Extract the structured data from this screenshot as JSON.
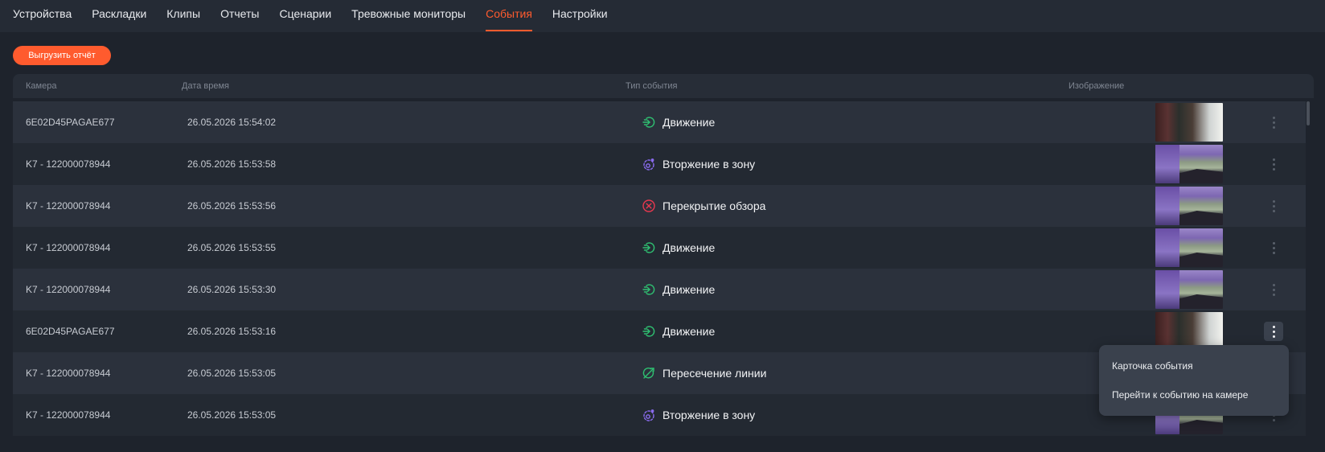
{
  "nav": {
    "tabs": [
      {
        "label": "Устройства",
        "active": false
      },
      {
        "label": "Раскладки",
        "active": false
      },
      {
        "label": "Клипы",
        "active": false
      },
      {
        "label": "Отчеты",
        "active": false
      },
      {
        "label": "Сценарии",
        "active": false
      },
      {
        "label": "Тревожные мониторы",
        "active": false
      },
      {
        "label": "События",
        "active": true
      },
      {
        "label": "Настройки",
        "active": false
      }
    ]
  },
  "toolbar": {
    "export_label": "Выгрузить отчёт"
  },
  "table": {
    "columns": {
      "camera": "Камера",
      "datetime": "Дата время",
      "event_type": "Тип события",
      "image": "Изображение"
    },
    "rows": [
      {
        "camera": "6E02D45PAGAE677",
        "datetime": "26.05.2026 15:54:02",
        "type": "Движение",
        "icon": "motion-icon",
        "thumb": "indoor"
      },
      {
        "camera": "K7 - 122000078944",
        "datetime": "26.05.2026 15:53:58",
        "type": "Вторжение в зону",
        "icon": "zone-intrusion-icon",
        "thumb": "outdoor"
      },
      {
        "camera": "K7 - 122000078944",
        "datetime": "26.05.2026 15:53:56",
        "type": "Перекрытие обзора",
        "icon": "view-blocked-icon",
        "thumb": "outdoor"
      },
      {
        "camera": "K7 - 122000078944",
        "datetime": "26.05.2026 15:53:55",
        "type": "Движение",
        "icon": "motion-icon",
        "thumb": "outdoor"
      },
      {
        "camera": "K7 - 122000078944",
        "datetime": "26.05.2026 15:53:30",
        "type": "Движение",
        "icon": "motion-icon",
        "thumb": "outdoor"
      },
      {
        "camera": "6E02D45PAGAE677",
        "datetime": "26.05.2026 15:53:16",
        "type": "Движение",
        "icon": "motion-icon",
        "thumb": "indoor",
        "menu_open": true
      },
      {
        "camera": "K7 - 122000078944",
        "datetime": "26.05.2026 15:53:05",
        "type": "Пересечение линии",
        "icon": "line-crossing-icon",
        "thumb": "outdoor"
      },
      {
        "camera": "K7 - 122000078944",
        "datetime": "26.05.2026 15:53:05",
        "type": "Вторжение в зону",
        "icon": "zone-intrusion-icon",
        "thumb": "outdoor"
      }
    ]
  },
  "context_menu": {
    "items": [
      "Карточка события",
      "Перейти к событию на камере"
    ]
  },
  "colors": {
    "accent": "#ff5b2e",
    "motion": "#2fbf71",
    "zone": "#8b6cf0",
    "blocked": "#e8384f"
  }
}
